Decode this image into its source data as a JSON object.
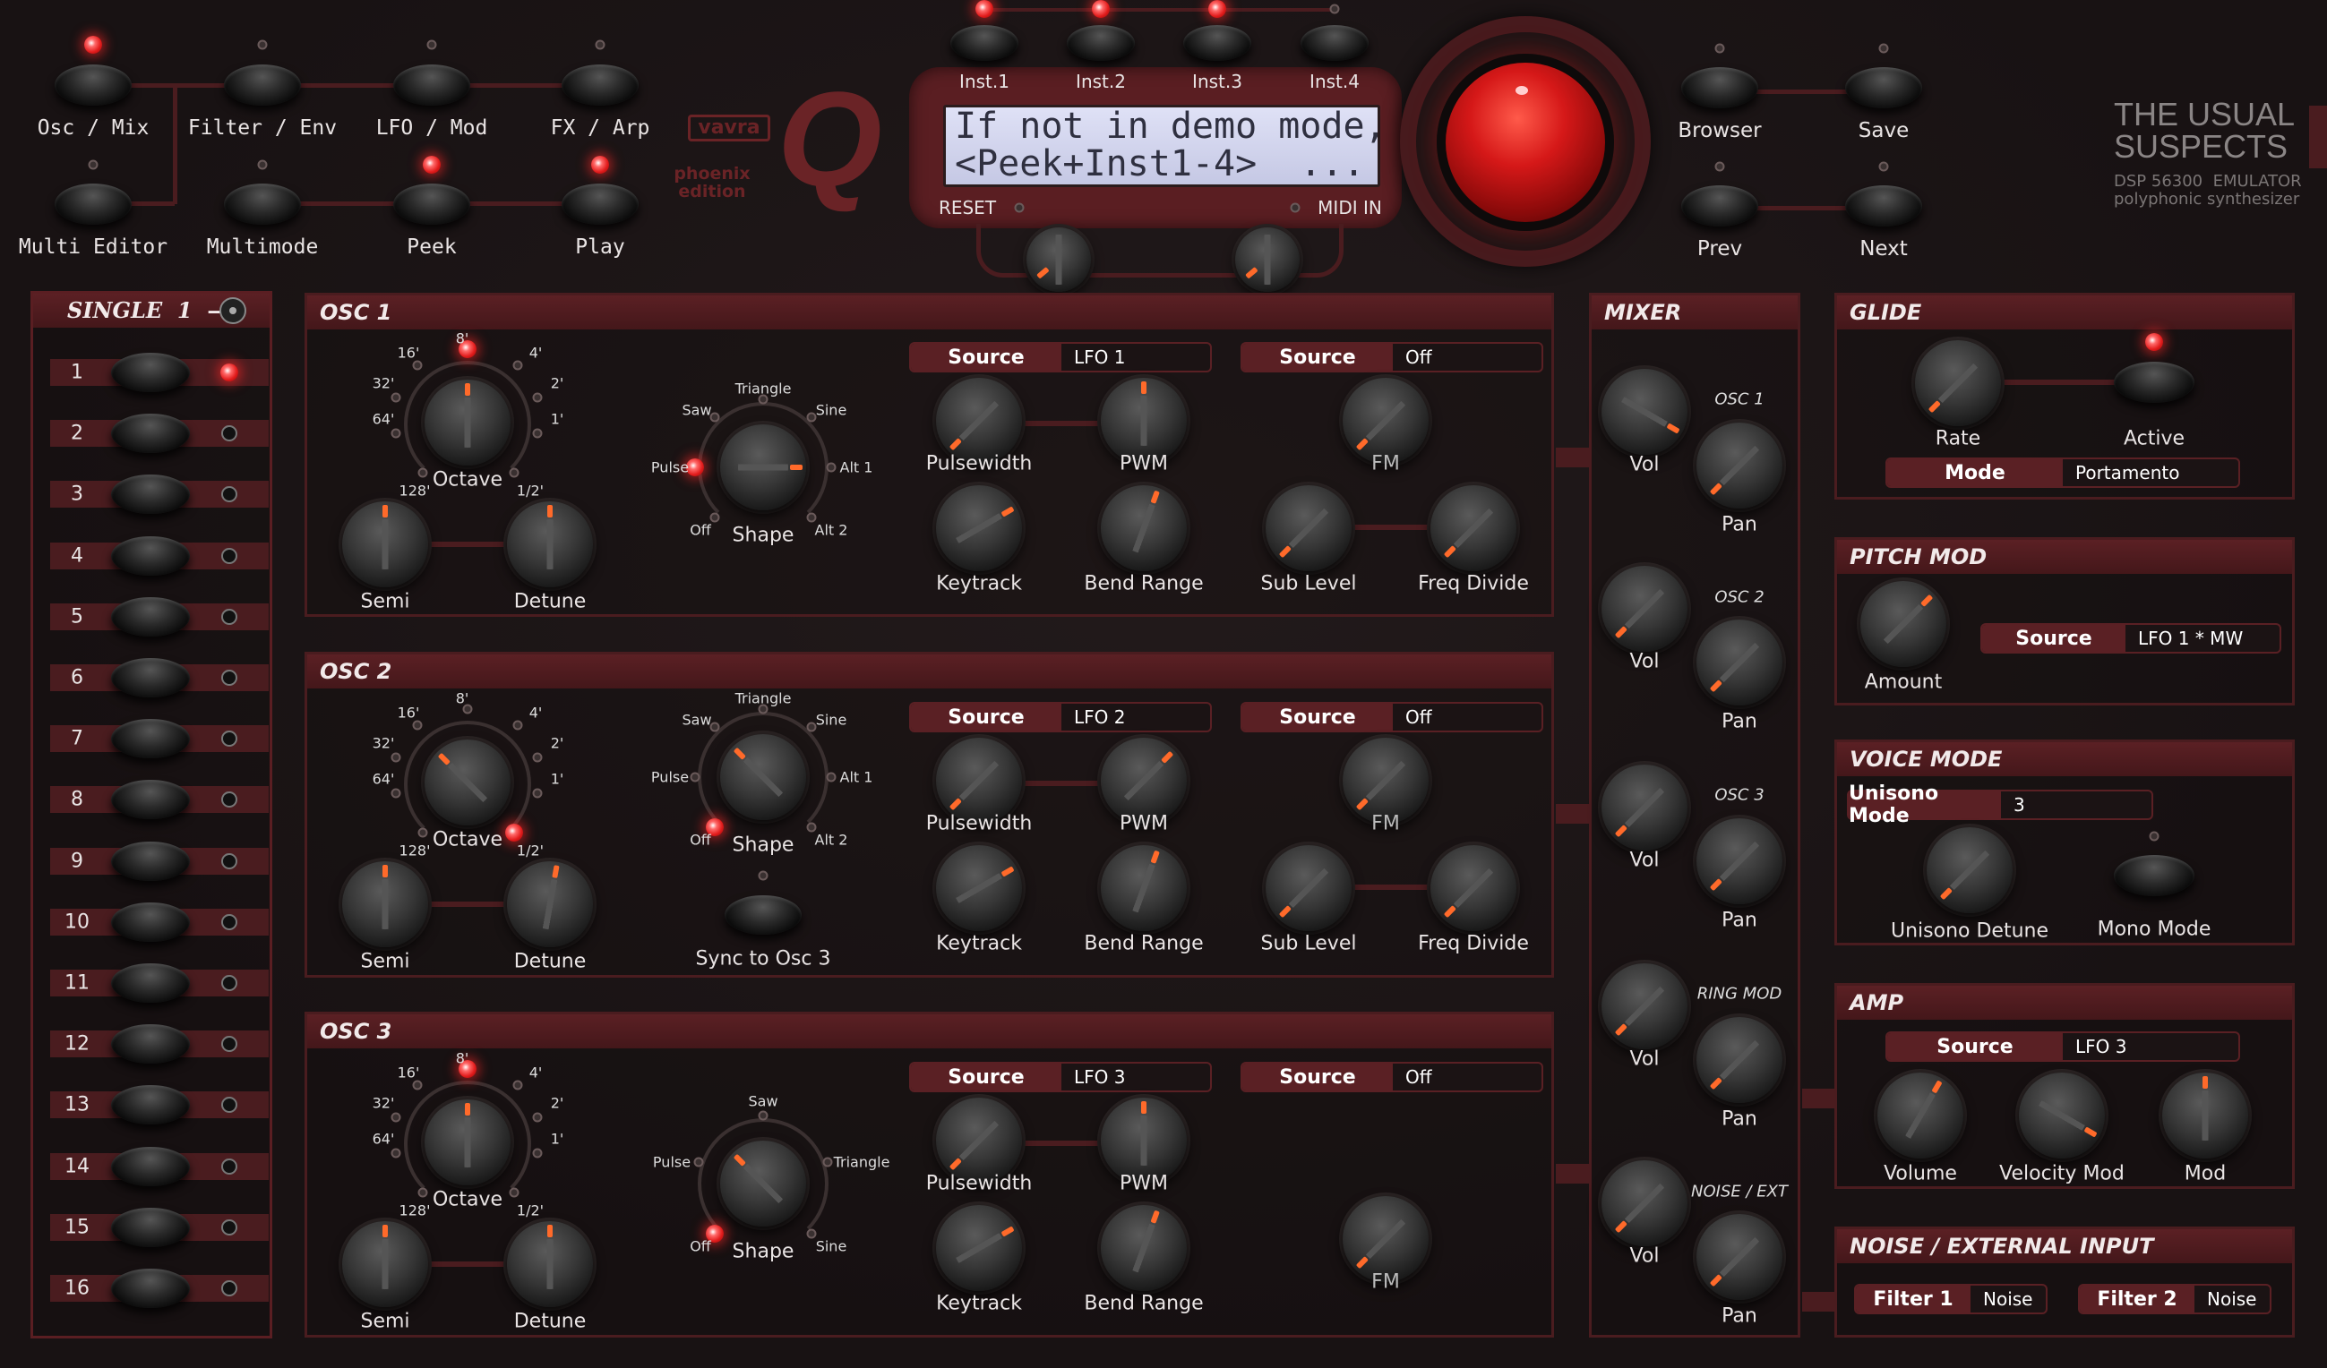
{
  "header": {
    "mode_buttons": [
      "Osc / Mix",
      "Filter / Env",
      "LFO / Mod",
      "FX / Arp",
      "Multi Editor",
      "Multimode",
      "Peek",
      "Play"
    ],
    "logo_brand": "vavra",
    "logo_edition": "phoenix\nedition",
    "logo_q": "Q",
    "inst_buttons": [
      "Inst.1",
      "Inst.2",
      "Inst.3",
      "Inst.4"
    ],
    "lcd_line1": "If not in demo mode,",
    "lcd_line2": "<Peek+Inst1-4>  ...",
    "reset_label": "RESET",
    "midi_in_label": "MIDI IN",
    "right_buttons": [
      "Browser",
      "Save",
      "Prev",
      "Next"
    ],
    "brand_title1": "THE USUAL",
    "brand_title2": "SUSPECTS",
    "brand_sub1": "DSP 56300  EMULATOR",
    "brand_sub2": "polyphonic synthesizer"
  },
  "single": {
    "title": "SINGLE",
    "part": "1",
    "dash": "—",
    "parts": [
      "1",
      "2",
      "3",
      "4",
      "5",
      "6",
      "7",
      "8",
      "9",
      "10",
      "11",
      "12",
      "13",
      "14",
      "15",
      "16"
    ]
  },
  "osc1": {
    "title": "OSC 1",
    "octave_label": "Octave",
    "oct_marks": [
      "16'",
      "8'",
      "4'",
      "32'",
      "2'",
      "64'",
      "1'",
      "128'",
      "1/2'"
    ],
    "semi": "Semi",
    "detune": "Detune",
    "shape_label": "Shape",
    "shapes": [
      "Triangle",
      "Saw",
      "Sine",
      "Pulse",
      "Alt 1",
      "Off",
      "Alt 2"
    ],
    "src1_key": "Source",
    "src1_val": "LFO 1",
    "src2_key": "Source",
    "src2_val": "Off",
    "pulsewidth": "Pulsewidth",
    "pwm": "PWM",
    "fm": "FM",
    "keytrack": "Keytrack",
    "bend": "Bend Range",
    "sublevel": "Sub Level",
    "freqdiv": "Freq Divide"
  },
  "osc2": {
    "title": "OSC 2",
    "octave_label": "Octave",
    "oct_marks": [
      "16'",
      "8'",
      "4'",
      "32'",
      "2'",
      "64'",
      "1'",
      "128'",
      "1/2'"
    ],
    "semi": "Semi",
    "detune": "Detune",
    "shape_label": "Shape",
    "shapes": [
      "Triangle",
      "Saw",
      "Sine",
      "Pulse",
      "Alt 1",
      "Off",
      "Alt 2"
    ],
    "sync": "Sync to Osc 3",
    "src1_key": "Source",
    "src1_val": "LFO 2",
    "src2_key": "Source",
    "src2_val": "Off",
    "pulsewidth": "Pulsewidth",
    "pwm": "PWM",
    "fm": "FM",
    "keytrack": "Keytrack",
    "bend": "Bend Range",
    "sublevel": "Sub Level",
    "freqdiv": "Freq Divide"
  },
  "osc3": {
    "title": "OSC 3",
    "octave_label": "Octave",
    "oct_marks": [
      "16'",
      "8'",
      "4'",
      "32'",
      "2'",
      "64'",
      "1'",
      "128'",
      "1/2'"
    ],
    "semi": "Semi",
    "detune": "Detune",
    "shape_label": "Shape",
    "shapes": [
      "Saw",
      "Pulse",
      "Triangle",
      "Off",
      "Sine"
    ],
    "src1_key": "Source",
    "src1_val": "LFO 3",
    "src2_key": "Source",
    "src2_val": "Off",
    "pulsewidth": "Pulsewidth",
    "pwm": "PWM",
    "fm": "FM",
    "keytrack": "Keytrack",
    "bend": "Bend Range"
  },
  "mixer": {
    "title": "MIXER",
    "vol": "Vol",
    "pan": "Pan",
    "channels": [
      "OSC 1",
      "OSC 2",
      "OSC 3",
      "RING MOD",
      "NOISE / EXT"
    ]
  },
  "glide": {
    "title": "GLIDE",
    "rate": "Rate",
    "active": "Active",
    "mode_key": "Mode",
    "mode_val": "Portamento"
  },
  "pitchmod": {
    "title": "PITCH MOD",
    "amount": "Amount",
    "src_key": "Source",
    "src_val": "LFO 1 * MW"
  },
  "voicemode": {
    "title": "VOICE MODE",
    "uni_key": "Unisono Mode",
    "uni_val": "3",
    "uni_detune": "Unisono Detune",
    "mono": "Mono Mode"
  },
  "amp": {
    "title": "AMP",
    "src_key": "Source",
    "src_val": "LFO 3",
    "volume": "Volume",
    "velmod": "Velocity Mod",
    "mod": "Mod"
  },
  "noise": {
    "title": "NOISE / EXTERNAL INPUT",
    "f1_key": "Filter 1",
    "f1_val": "Noise",
    "f2_key": "Filter 2",
    "f2_val": "Noise"
  }
}
